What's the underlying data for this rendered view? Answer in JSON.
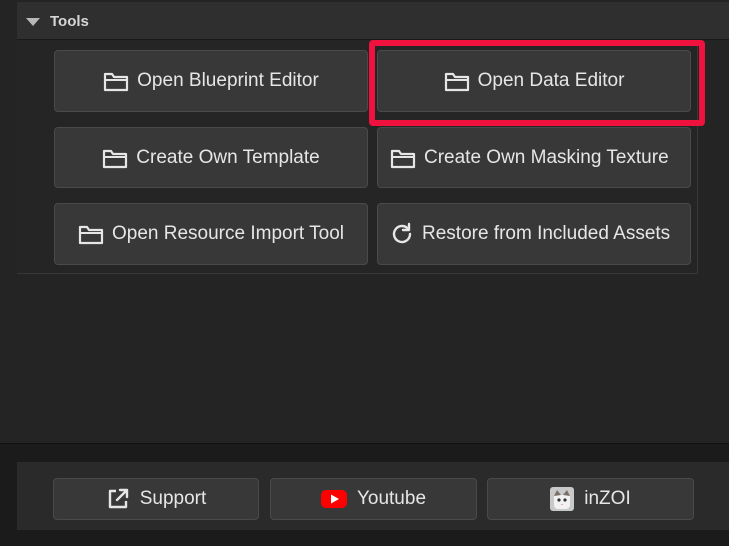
{
  "tools": {
    "title": "Tools",
    "buttons": [
      {
        "label": "Open Blueprint Editor",
        "icon": "folder-icon"
      },
      {
        "label": "Open Data Editor",
        "icon": "folder-icon"
      },
      {
        "label": "Create Own Template",
        "icon": "folder-icon"
      },
      {
        "label": "Create Own Masking Texture",
        "icon": "folder-icon"
      },
      {
        "label": "Open Resource Import Tool",
        "icon": "folder-icon"
      },
      {
        "label": "Restore from Included Assets",
        "icon": "refresh-icon"
      }
    ]
  },
  "footer": {
    "support_label": "Support",
    "youtube_label": "Youtube",
    "inzoi_label": "inZOI"
  },
  "colors": {
    "highlight": "#f0123e",
    "youtube_red": "#ff0000",
    "button_bg": "#383838"
  }
}
